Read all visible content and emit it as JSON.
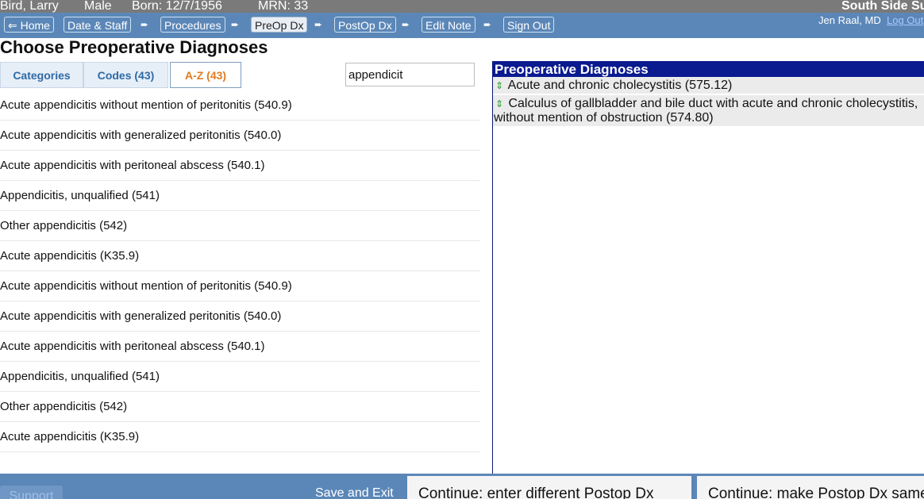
{
  "patient": {
    "name": "Bird, Larry",
    "sex": "Male",
    "born": "Born: 12/7/1956",
    "mrn": "MRN: 33"
  },
  "facility": "South Side Su",
  "user": {
    "name": "Jen Raal, MD",
    "logout": "Log Out"
  },
  "nav": {
    "arrow": "➨",
    "items": [
      {
        "label": "⇐ Home"
      },
      {
        "label": "Date & Staff"
      },
      {
        "label": "Procedures"
      },
      {
        "label": "PreOp Dx"
      },
      {
        "label": "PostOp Dx"
      },
      {
        "label": "Edit Note"
      },
      {
        "label": "Sign Out"
      }
    ],
    "active_index": 3
  },
  "page_title": "Choose Preoperative Diagnoses",
  "tabs": [
    {
      "label": "Categories"
    },
    {
      "label": "Codes (43)"
    },
    {
      "label": "A-Z (43)"
    }
  ],
  "selected_tab": "A-Z (43)",
  "search": {
    "value": "appendicit"
  },
  "results": [
    "Acute appendicitis without mention of peritonitis (540.9)",
    "Acute appendicitis with generalized peritonitis (540.0)",
    "Acute appendicitis with peritoneal abscess (540.1)",
    "Appendicitis, unqualified (541)",
    "Other appendicitis (542)",
    "Acute appendicitis (K35.9)",
    "Acute appendicitis without mention of peritonitis (540.9)",
    "Acute appendicitis with generalized peritonitis (540.0)",
    "Acute appendicitis with peritoneal abscess (540.1)",
    "Appendicitis, unqualified (541)",
    "Other appendicitis (542)",
    "Acute appendicitis (K35.9)"
  ],
  "selected_panel": {
    "title": "Preoperative Diagnoses",
    "icon": "⇕",
    "items": [
      "Acute and chronic cholecystitis (575.12)",
      "Calculus of gallbladder and bile duct with acute and chronic cholecystitis, without mention of obstruction (574.80)"
    ]
  },
  "footer": {
    "support": "Support",
    "save_exit": "Save and Exit",
    "continue_different": "Continue: enter different Postop Dx",
    "continue_same": "Continue: make Postop Dx same"
  },
  "colors": {
    "nav_blue": "#5b87b8",
    "panel_header": "#0a1a8f",
    "active_tab_text": "#e07c1f",
    "tab_text": "#2f6aa6",
    "patient_bar": "#7a7a7a",
    "logout_link": "#a9c7ff",
    "move_icon": "#2e9a2e"
  }
}
